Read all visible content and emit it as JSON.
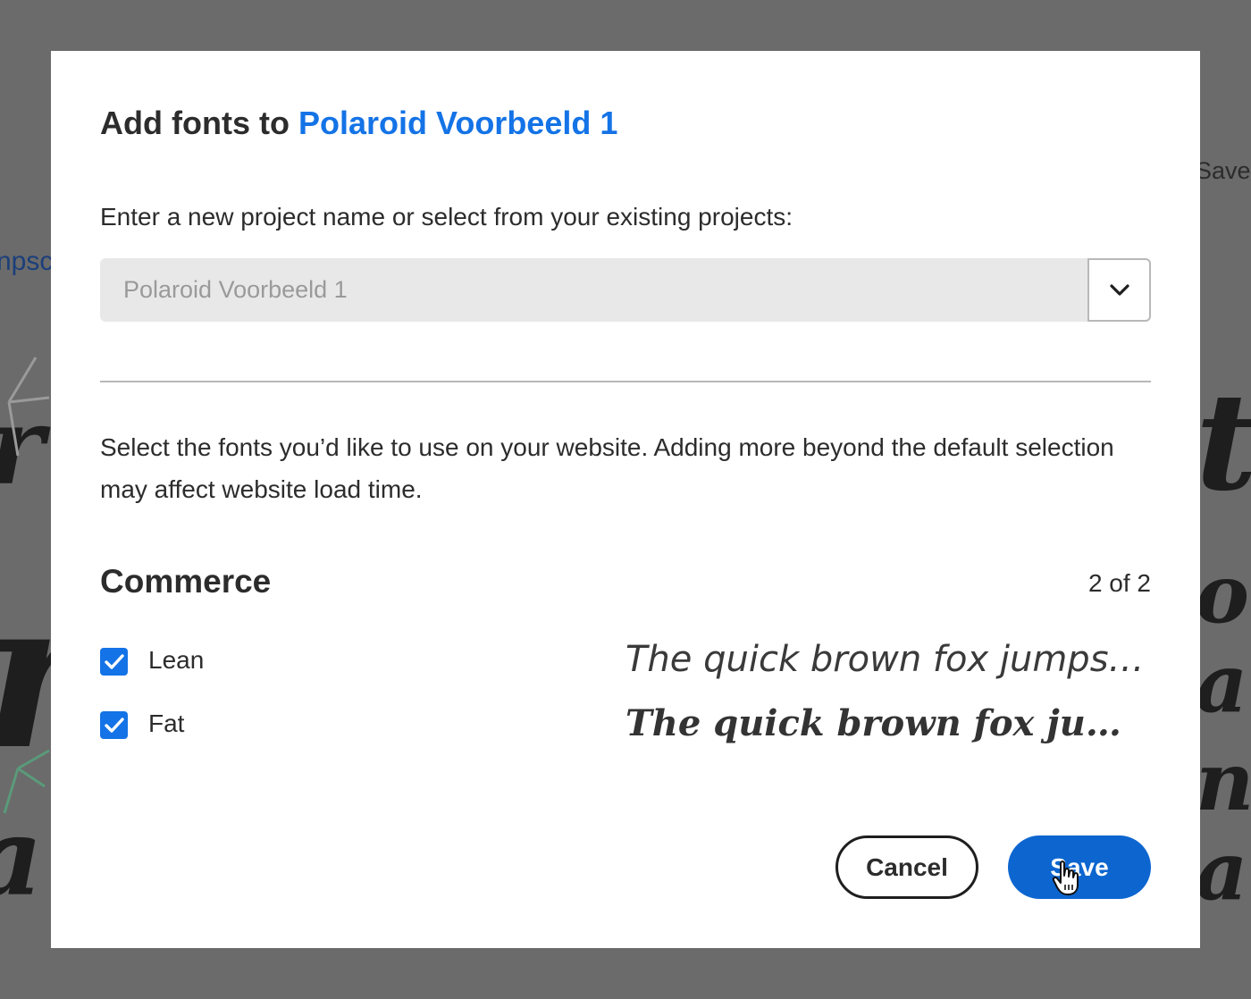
{
  "background": {
    "save_text": "Save",
    "link_text": "npsc"
  },
  "dialog": {
    "title_prefix": "Add fonts to",
    "title_project": "Polaroid Voorbeeld 1",
    "prompt": "Enter a new project name or select from your existing projects:",
    "project_input_placeholder": "Polaroid Voorbeeld 1",
    "description": "Select the fonts you’d like to use on your website. Adding more beyond the default selection may affect website load time.",
    "family": {
      "name": "Commerce",
      "count": "2 of 2",
      "fonts": [
        {
          "label": "Lean",
          "checked": true,
          "sample": "The quick brown fox jumps over the lazy dog"
        },
        {
          "label": "Fat",
          "checked": true,
          "sample": "The quick brown fox jumps over the lazy dog"
        }
      ]
    },
    "cancel_label": "Cancel",
    "save_label": "Save"
  },
  "colors": {
    "accent": "#1473e6",
    "save_button": "#0d66d0",
    "backdrop": "#6b6b6b"
  },
  "icons": {
    "dropdown": "chevron-down-icon",
    "checkbox": "checkmark-icon",
    "cursor": "hand-pointer-icon"
  }
}
